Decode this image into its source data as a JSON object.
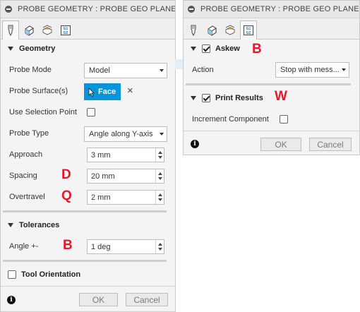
{
  "left_dialog": {
    "title": "PROBE GEOMETRY : PROBE GEO PLANE ANGLE",
    "geometry": {
      "header": "Geometry",
      "probe_mode_label": "Probe Mode",
      "probe_mode_value": "Model",
      "probe_surface_label": "Probe Surface(s)",
      "face_button": "Face",
      "clear_icon": "×",
      "use_selection_point_label": "Use Selection Point",
      "probe_type_label": "Probe Type",
      "probe_type_value": "Angle along Y-axis",
      "approach_label": "Approach",
      "approach_value": "3 mm",
      "spacing_label": "Spacing",
      "spacing_value": "20 mm",
      "overtravel_label": "Overtravel",
      "overtravel_value": "2 mm"
    },
    "tolerances": {
      "header": "Tolerances",
      "angle_label": "Angle +-",
      "angle_value": "1 deg"
    },
    "tool_orientation_label": "Tool Orientation",
    "ok": "OK",
    "cancel": "Cancel",
    "info": "i"
  },
  "right_dialog": {
    "title": "PROBE GEOMETRY : PROBE GEO PLANE ANGLE",
    "askew": {
      "header": "Askew",
      "action_label": "Action",
      "action_value": "Stop with mess..."
    },
    "print_results": {
      "header": "Print Results",
      "increment_component_label": "Increment Component"
    },
    "ok": "OK",
    "cancel": "Cancel",
    "info": "i"
  },
  "annotations": {
    "spacing": "D",
    "overtravel": "Q",
    "angle": "B",
    "askew": "B",
    "print_results": "W"
  },
  "icons": [
    "tool-tab-icon",
    "geometry-tab-icon",
    "heights-tab-icon",
    "g-code-tab-icon"
  ],
  "colors": {
    "accent": "#0696d7",
    "annotation": "#e8182b"
  }
}
